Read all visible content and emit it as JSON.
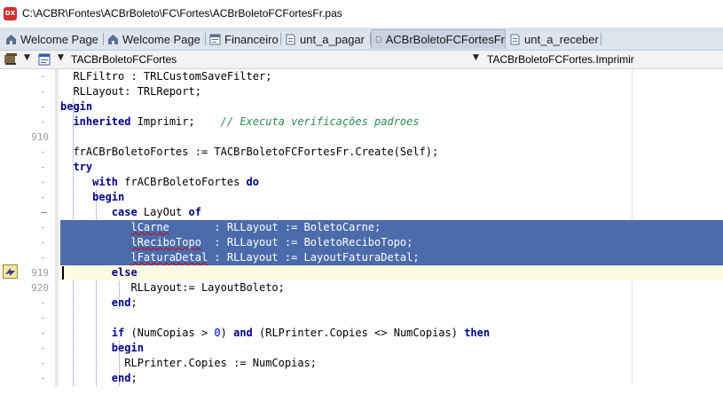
{
  "window": {
    "app_icon_text": "DX",
    "title": "C:\\ACBR\\Fontes\\ACBrBoleto\\FC\\Fortes\\ACBrBoletoFCFortesFr.pas"
  },
  "tabs": [
    {
      "label": "Welcome Page",
      "icon": "welcome-page-icon",
      "active": false
    },
    {
      "label": "Welcome Page",
      "icon": "welcome-page-icon",
      "active": false
    },
    {
      "label": "Financeiro",
      "icon": "form-icon",
      "active": false
    },
    {
      "label": "unt_a_pagar",
      "icon": "unit-file-icon",
      "active": false
    },
    {
      "label": "ACBrBoletoFCFortesFr",
      "icon": "unit-file-icon",
      "active": true
    },
    {
      "label": "unt_a_receber",
      "icon": "unit-file-icon",
      "active": false
    }
  ],
  "toolbar": {
    "class_combo_value": "TACBrBoletoFCFortes",
    "method_combo_value": "TACBrBoletoFCFortes.Imprimir"
  },
  "gutter": {
    "line_910": "910",
    "line_919": "919",
    "line_920": "920"
  },
  "colors": {
    "selection": "#4b6bab",
    "keyword": "#00008b",
    "comment": "#2e8b57",
    "number": "#0000cd",
    "tabbar": "#dee4ee",
    "current_line": "#fdfbe2"
  },
  "code": {
    "l1_text": "  RLFiltro : TRLCustomSaveFilter;",
    "l2_text": "  RLLayout: TRLReport;",
    "l3_kw": "begin",
    "l4_kw": "inherited",
    "l4_text": " Imprimir;    ",
    "l4_comment": "// Executa verificações padroes",
    "l6_text": "  frACBrBoletoFortes := TACBrBoletoFCFortesFr.Create(Self);",
    "l7_kw": "try",
    "l8_kw1": "with",
    "l8_text": " frACBrBoletoFortes ",
    "l8_kw2": "do",
    "l9_kw": "begin",
    "l10_kw1": "case",
    "l10_text": " LayOut ",
    "l10_kw2": "of",
    "l11_ident": "lCarne",
    "l11_rest": "       : RLLayout := BoletoCarne;",
    "l12_ident": "lReciboTopo",
    "l12_rest": "  : RLLayout := BoletoReciboTopo;",
    "l13_ident": "lFaturaDetal",
    "l13_rest": " : RLLayout := LayoutFaturaDetal;",
    "l14_kw": "else",
    "l15_text": "RLLayout:= LayoutBoleto;",
    "l16_kw": "end",
    "l16_punct": ";",
    "l18_kw_if": "if",
    "l18_a": " (NumCopias > ",
    "l18_num": "0",
    "l18_b": ") ",
    "l18_kw_and": "and",
    "l18_c": " (RLPrinter.Copies <> NumCopias) ",
    "l18_kw_then": "then",
    "l19_kw": "begin",
    "l20_text": "RLPrinter.Copies := NumCopias;",
    "l21_kw": "end",
    "l21_punct": ";"
  }
}
